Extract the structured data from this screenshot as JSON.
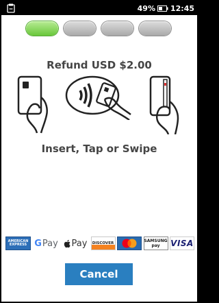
{
  "status_bar": {
    "battery": "49%",
    "time": "12:45"
  },
  "progress": {
    "total_steps": 4,
    "current_step": 1
  },
  "refund_title": "Refund USD $2.00",
  "prompt": "Insert, Tap or Swipe",
  "payment_logos": {
    "amex": "AMERICAN EXPRESS",
    "gpay_g": "G",
    "gpay_text": "Pay",
    "apple_pay_text": "Pay",
    "discover": "DISCOVER",
    "samsung_1": "SAMSUNG",
    "samsung_2": "pay",
    "visa": "VISA"
  },
  "cancel_label": "Cancel",
  "colors": {
    "accent": "#2a7fc0",
    "step_active": "#69c73a",
    "step_inactive": "#a9a9a9"
  }
}
